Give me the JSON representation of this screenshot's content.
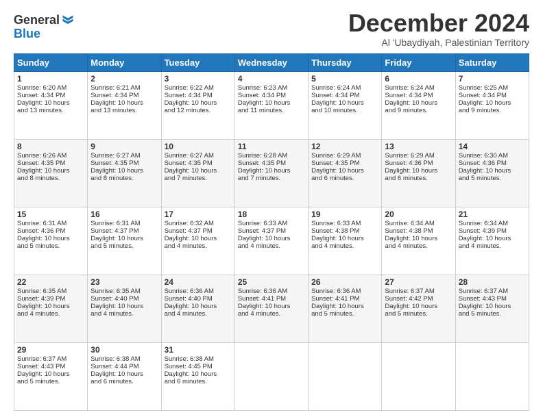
{
  "logo": {
    "line1": "General",
    "line2": "Blue"
  },
  "title": "December 2024",
  "location": "Al 'Ubaydiyah, Palestinian Territory",
  "headers": [
    "Sunday",
    "Monday",
    "Tuesday",
    "Wednesday",
    "Thursday",
    "Friday",
    "Saturday"
  ],
  "weeks": [
    [
      {
        "day": "1",
        "lines": [
          "Sunrise: 6:20 AM",
          "Sunset: 4:34 PM",
          "Daylight: 10 hours",
          "and 13 minutes."
        ]
      },
      {
        "day": "2",
        "lines": [
          "Sunrise: 6:21 AM",
          "Sunset: 4:34 PM",
          "Daylight: 10 hours",
          "and 13 minutes."
        ]
      },
      {
        "day": "3",
        "lines": [
          "Sunrise: 6:22 AM",
          "Sunset: 4:34 PM",
          "Daylight: 10 hours",
          "and 12 minutes."
        ]
      },
      {
        "day": "4",
        "lines": [
          "Sunrise: 6:23 AM",
          "Sunset: 4:34 PM",
          "Daylight: 10 hours",
          "and 11 minutes."
        ]
      },
      {
        "day": "5",
        "lines": [
          "Sunrise: 6:24 AM",
          "Sunset: 4:34 PM",
          "Daylight: 10 hours",
          "and 10 minutes."
        ]
      },
      {
        "day": "6",
        "lines": [
          "Sunrise: 6:24 AM",
          "Sunset: 4:34 PM",
          "Daylight: 10 hours",
          "and 9 minutes."
        ]
      },
      {
        "day": "7",
        "lines": [
          "Sunrise: 6:25 AM",
          "Sunset: 4:34 PM",
          "Daylight: 10 hours",
          "and 9 minutes."
        ]
      }
    ],
    [
      {
        "day": "8",
        "lines": [
          "Sunrise: 6:26 AM",
          "Sunset: 4:35 PM",
          "Daylight: 10 hours",
          "and 8 minutes."
        ]
      },
      {
        "day": "9",
        "lines": [
          "Sunrise: 6:27 AM",
          "Sunset: 4:35 PM",
          "Daylight: 10 hours",
          "and 8 minutes."
        ]
      },
      {
        "day": "10",
        "lines": [
          "Sunrise: 6:27 AM",
          "Sunset: 4:35 PM",
          "Daylight: 10 hours",
          "and 7 minutes."
        ]
      },
      {
        "day": "11",
        "lines": [
          "Sunrise: 6:28 AM",
          "Sunset: 4:35 PM",
          "Daylight: 10 hours",
          "and 7 minutes."
        ]
      },
      {
        "day": "12",
        "lines": [
          "Sunrise: 6:29 AM",
          "Sunset: 4:35 PM",
          "Daylight: 10 hours",
          "and 6 minutes."
        ]
      },
      {
        "day": "13",
        "lines": [
          "Sunrise: 6:29 AM",
          "Sunset: 4:36 PM",
          "Daylight: 10 hours",
          "and 6 minutes."
        ]
      },
      {
        "day": "14",
        "lines": [
          "Sunrise: 6:30 AM",
          "Sunset: 4:36 PM",
          "Daylight: 10 hours",
          "and 5 minutes."
        ]
      }
    ],
    [
      {
        "day": "15",
        "lines": [
          "Sunrise: 6:31 AM",
          "Sunset: 4:36 PM",
          "Daylight: 10 hours",
          "and 5 minutes."
        ]
      },
      {
        "day": "16",
        "lines": [
          "Sunrise: 6:31 AM",
          "Sunset: 4:37 PM",
          "Daylight: 10 hours",
          "and 5 minutes."
        ]
      },
      {
        "day": "17",
        "lines": [
          "Sunrise: 6:32 AM",
          "Sunset: 4:37 PM",
          "Daylight: 10 hours",
          "and 4 minutes."
        ]
      },
      {
        "day": "18",
        "lines": [
          "Sunrise: 6:33 AM",
          "Sunset: 4:37 PM",
          "Daylight: 10 hours",
          "and 4 minutes."
        ]
      },
      {
        "day": "19",
        "lines": [
          "Sunrise: 6:33 AM",
          "Sunset: 4:38 PM",
          "Daylight: 10 hours",
          "and 4 minutes."
        ]
      },
      {
        "day": "20",
        "lines": [
          "Sunrise: 6:34 AM",
          "Sunset: 4:38 PM",
          "Daylight: 10 hours",
          "and 4 minutes."
        ]
      },
      {
        "day": "21",
        "lines": [
          "Sunrise: 6:34 AM",
          "Sunset: 4:39 PM",
          "Daylight: 10 hours",
          "and 4 minutes."
        ]
      }
    ],
    [
      {
        "day": "22",
        "lines": [
          "Sunrise: 6:35 AM",
          "Sunset: 4:39 PM",
          "Daylight: 10 hours",
          "and 4 minutes."
        ]
      },
      {
        "day": "23",
        "lines": [
          "Sunrise: 6:35 AM",
          "Sunset: 4:40 PM",
          "Daylight: 10 hours",
          "and 4 minutes."
        ]
      },
      {
        "day": "24",
        "lines": [
          "Sunrise: 6:36 AM",
          "Sunset: 4:40 PM",
          "Daylight: 10 hours",
          "and 4 minutes."
        ]
      },
      {
        "day": "25",
        "lines": [
          "Sunrise: 6:36 AM",
          "Sunset: 4:41 PM",
          "Daylight: 10 hours",
          "and 4 minutes."
        ]
      },
      {
        "day": "26",
        "lines": [
          "Sunrise: 6:36 AM",
          "Sunset: 4:41 PM",
          "Daylight: 10 hours",
          "and 5 minutes."
        ]
      },
      {
        "day": "27",
        "lines": [
          "Sunrise: 6:37 AM",
          "Sunset: 4:42 PM",
          "Daylight: 10 hours",
          "and 5 minutes."
        ]
      },
      {
        "day": "28",
        "lines": [
          "Sunrise: 6:37 AM",
          "Sunset: 4:43 PM",
          "Daylight: 10 hours",
          "and 5 minutes."
        ]
      }
    ],
    [
      {
        "day": "29",
        "lines": [
          "Sunrise: 6:37 AM",
          "Sunset: 4:43 PM",
          "Daylight: 10 hours",
          "and 5 minutes."
        ]
      },
      {
        "day": "30",
        "lines": [
          "Sunrise: 6:38 AM",
          "Sunset: 4:44 PM",
          "Daylight: 10 hours",
          "and 6 minutes."
        ]
      },
      {
        "day": "31",
        "lines": [
          "Sunrise: 6:38 AM",
          "Sunset: 4:45 PM",
          "Daylight: 10 hours",
          "and 6 minutes."
        ]
      },
      null,
      null,
      null,
      null
    ]
  ]
}
